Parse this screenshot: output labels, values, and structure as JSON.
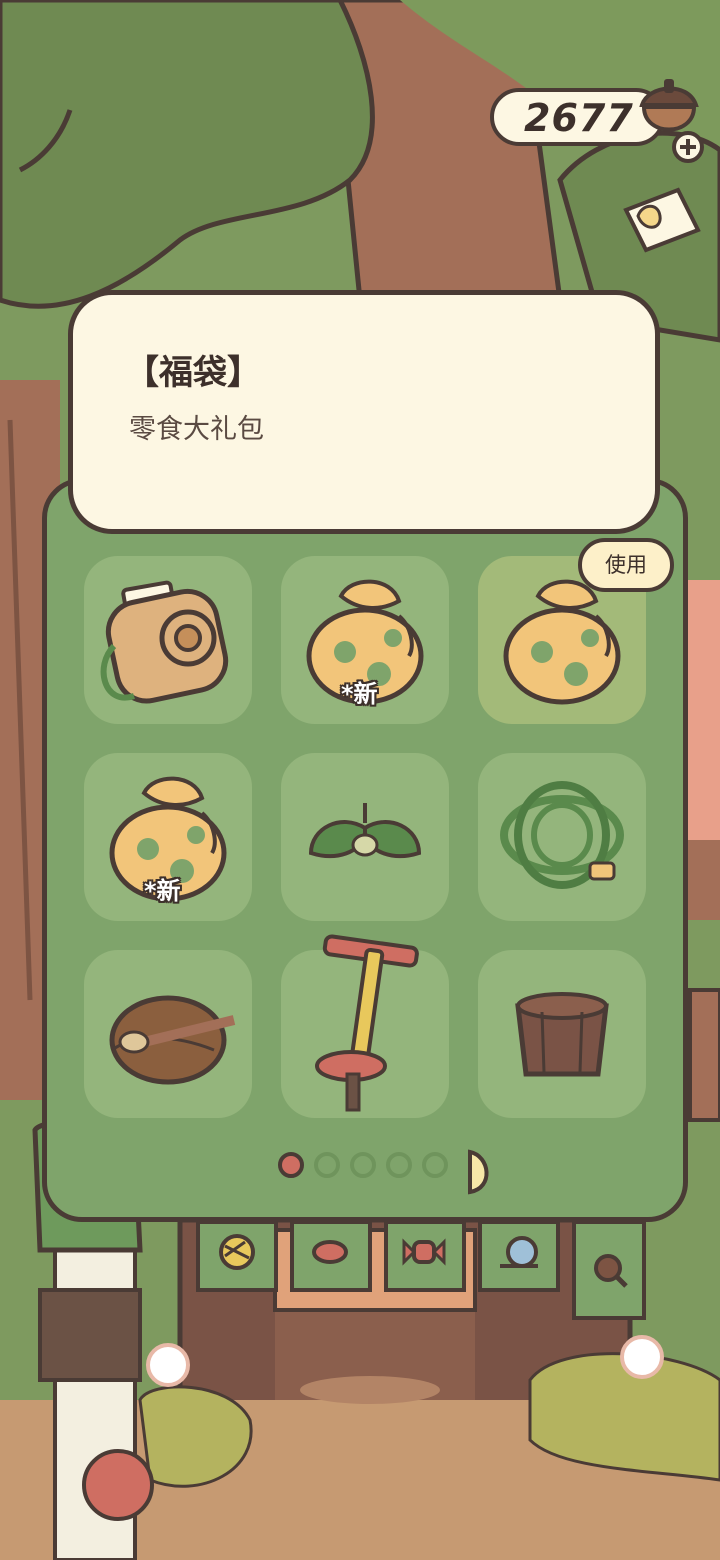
{
  "currency": {
    "amount": "2677"
  },
  "item_info": {
    "title": "【福袋】",
    "description": "零食大礼包"
  },
  "use_button": {
    "label": "使用"
  },
  "inventory": {
    "slots": [
      {
        "icon": "camera-icon",
        "badge": ""
      },
      {
        "icon": "lucky-bag-icon",
        "badge": "*新"
      },
      {
        "icon": "lucky-bag-icon",
        "badge": "",
        "selected": true
      },
      {
        "icon": "lucky-bag-icon",
        "badge": "*新"
      },
      {
        "icon": "lamp-leaf-icon",
        "badge": ""
      },
      {
        "icon": "rope-icon",
        "badge": ""
      },
      {
        "icon": "bread-icon",
        "badge": ""
      },
      {
        "icon": "pickaxe-icon",
        "badge": ""
      },
      {
        "icon": "wooden-bucket-icon",
        "badge": ""
      }
    ],
    "pager": {
      "current_page": 1,
      "total_pages": 5
    }
  },
  "shop_tabs": [
    {
      "icon": "yarn-icon"
    },
    {
      "icon": "leaf-icon"
    },
    {
      "icon": "candy-icon"
    },
    {
      "icon": "snail-icon"
    },
    {
      "icon": "magnifier-icon"
    }
  ],
  "colors": {
    "outline": "#4a3b35",
    "panel_green": "#7fa46b",
    "card_cream": "#fdf7e3",
    "active_dot": "#cf6e62"
  }
}
